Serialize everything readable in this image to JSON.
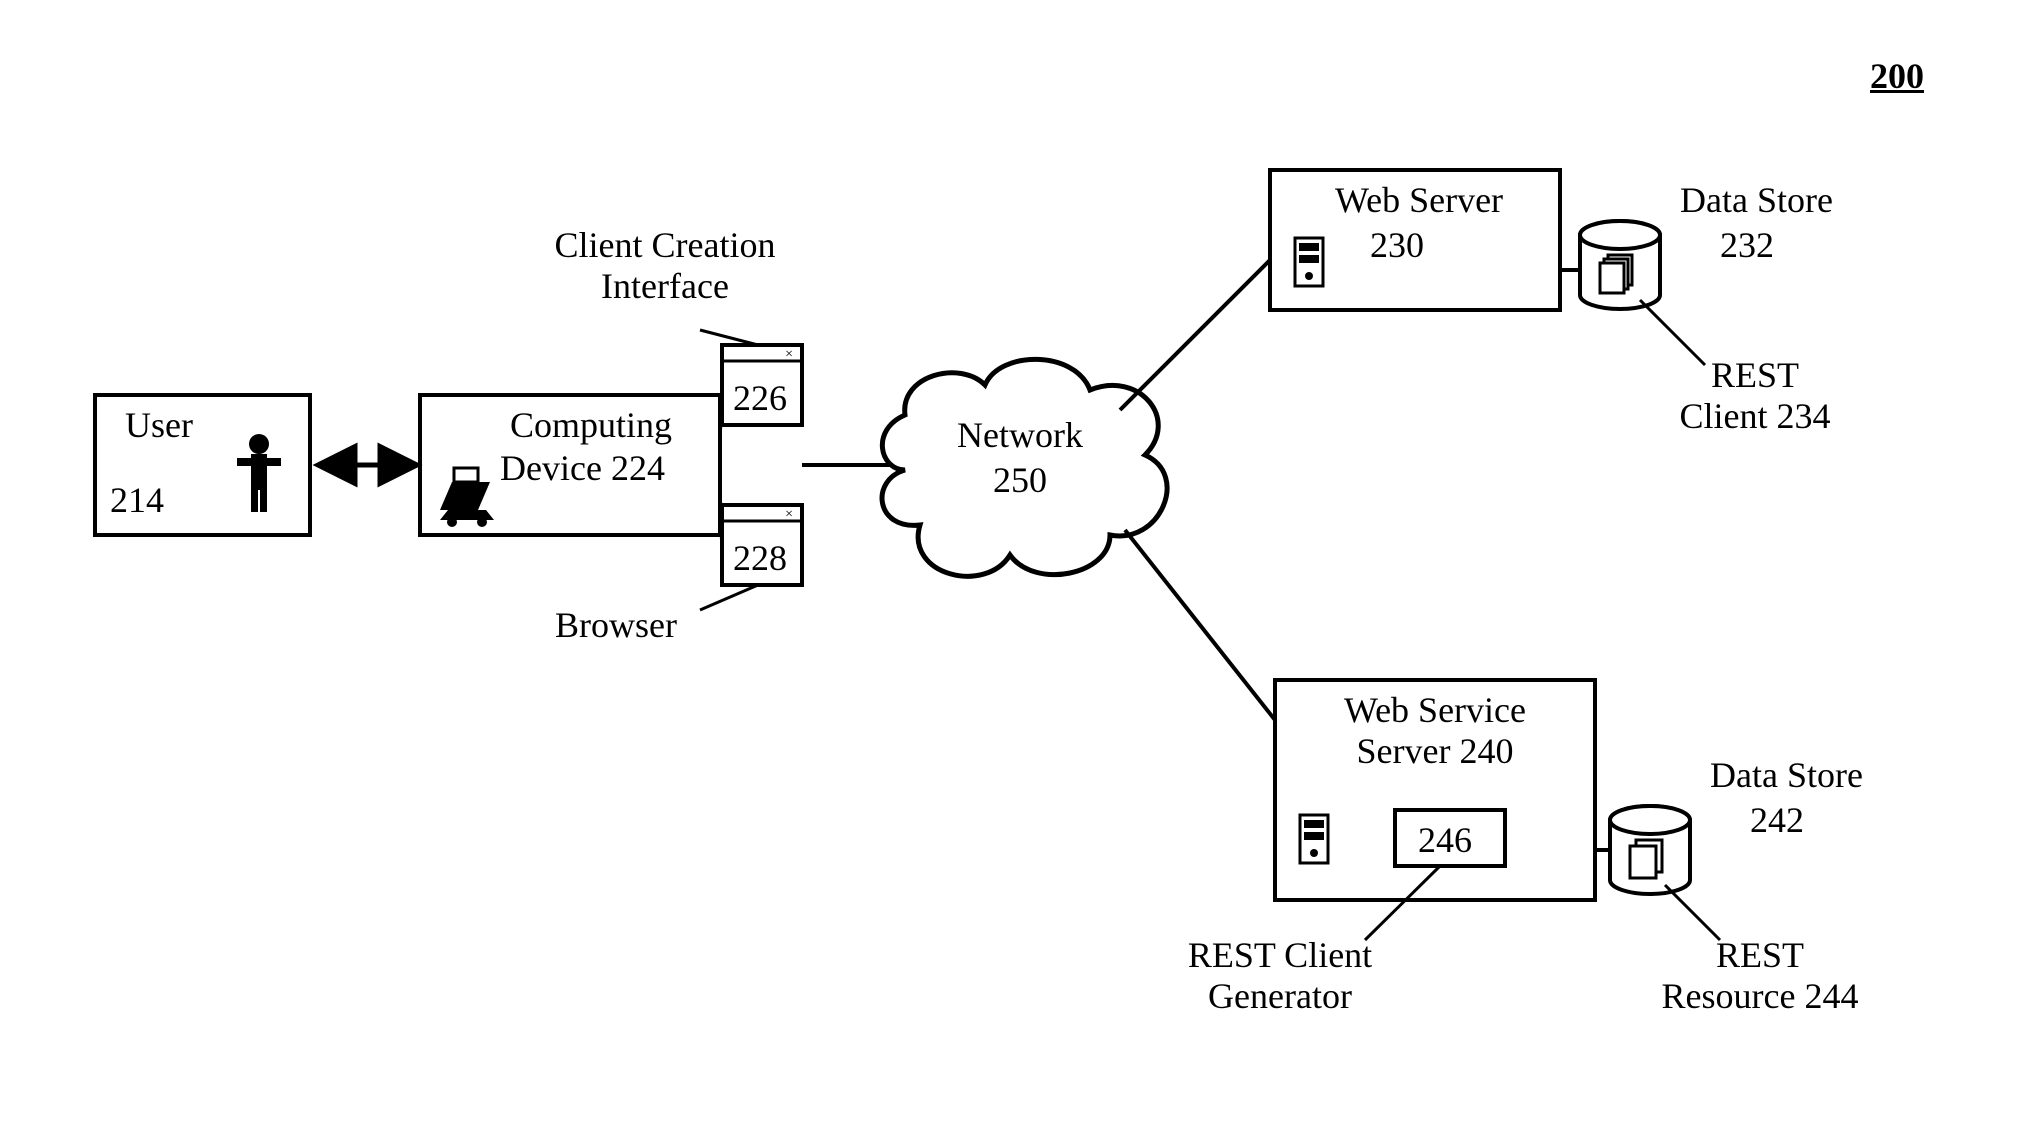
{
  "figure_number": "200",
  "user": {
    "label": "User",
    "ref": "214"
  },
  "computing_device": {
    "label1": "Computing",
    "label2": "Device",
    "ref": "224"
  },
  "client_creation_interface": {
    "label_line1": "Client Creation",
    "label_line2": "Interface",
    "ref": "226"
  },
  "browser": {
    "label": "Browser",
    "ref": "228"
  },
  "network": {
    "label": "Network",
    "ref": "250"
  },
  "web_server": {
    "label": "Web Server",
    "ref": "230",
    "data_store": {
      "label": "Data Store",
      "ref": "232"
    },
    "rest_client": {
      "label_line1": "REST",
      "label_line2": "Client",
      "ref": "234"
    }
  },
  "web_service_server": {
    "label_line1": "Web Service",
    "label_line2": "Server",
    "ref": "240",
    "inner_box_ref": "246",
    "rest_client_generator": {
      "label_line1": "REST Client",
      "label_line2": "Generator"
    },
    "data_store": {
      "label": "Data Store",
      "ref": "242"
    },
    "rest_resource": {
      "label_line1": "REST",
      "label_line2": "Resource",
      "ref": "244"
    }
  }
}
